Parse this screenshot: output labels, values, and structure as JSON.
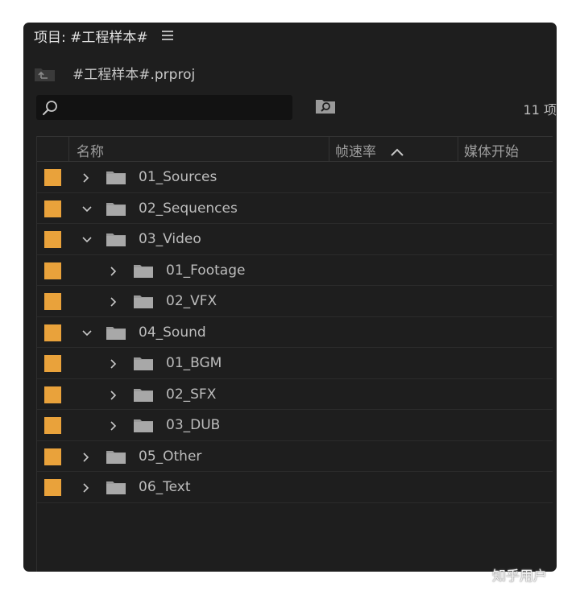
{
  "panel": {
    "title": "项目: #工程样本#",
    "menu_icon": "hamburger-menu-icon"
  },
  "project": {
    "name": "#工程样本#.prproj",
    "icon": "project-folder-up-icon"
  },
  "search": {
    "value": "",
    "placeholder": "",
    "icon": "magnifier-icon"
  },
  "bin_search_icon": "new-search-bin-icon",
  "item_count": "11 项",
  "columns": {
    "name": "名称",
    "frame_rate": "帧速率",
    "media_start": "媒体开始",
    "sort_indicator": "sort-ascending-icon"
  },
  "colors": {
    "label": "#e9a23b",
    "panel_bg": "#1e1e1e"
  },
  "rows": [
    {
      "name": "01_Sources",
      "expanded": false,
      "depth": 0
    },
    {
      "name": "02_Sequences",
      "expanded": true,
      "depth": 0
    },
    {
      "name": "03_Video",
      "expanded": true,
      "depth": 0
    },
    {
      "name": "01_Footage",
      "expanded": false,
      "depth": 1
    },
    {
      "name": "02_VFX",
      "expanded": false,
      "depth": 1
    },
    {
      "name": "04_Sound",
      "expanded": true,
      "depth": 0
    },
    {
      "name": "01_BGM",
      "expanded": false,
      "depth": 1
    },
    {
      "name": "02_SFX",
      "expanded": false,
      "depth": 1
    },
    {
      "name": "03_DUB",
      "expanded": false,
      "depth": 1
    },
    {
      "name": "05_Other",
      "expanded": false,
      "depth": 0
    },
    {
      "name": "06_Text",
      "expanded": false,
      "depth": 0
    }
  ],
  "watermark": "知乎用户"
}
